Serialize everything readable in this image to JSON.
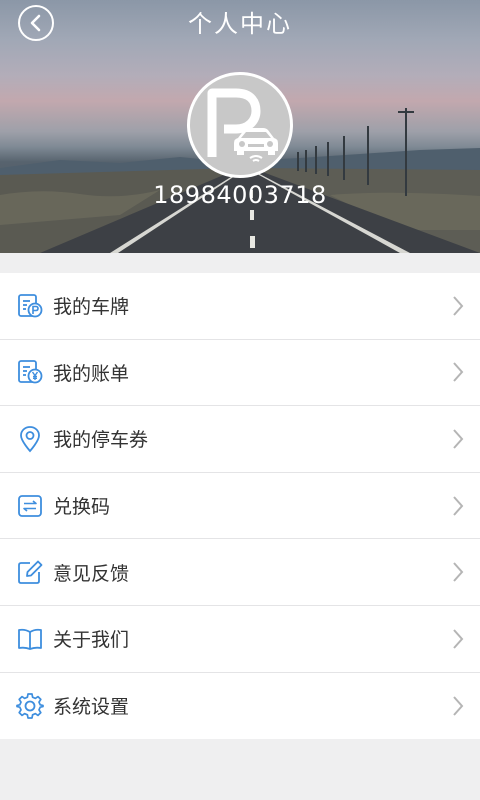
{
  "header": {
    "title": "个人中心",
    "phone": "18984003718"
  },
  "menu": [
    {
      "label": "我的车牌",
      "icon": "license-plate-icon"
    },
    {
      "label": "我的账单",
      "icon": "bill-icon"
    },
    {
      "label": "我的停车券",
      "icon": "location-pin-icon"
    },
    {
      "label": "兑换码",
      "icon": "exchange-icon"
    },
    {
      "label": "意见反馈",
      "icon": "edit-icon"
    },
    {
      "label": "关于我们",
      "icon": "book-icon"
    },
    {
      "label": "系统设置",
      "icon": "gear-icon"
    }
  ],
  "colors": {
    "accent": "#3e8ede",
    "background": "#efeff0"
  }
}
